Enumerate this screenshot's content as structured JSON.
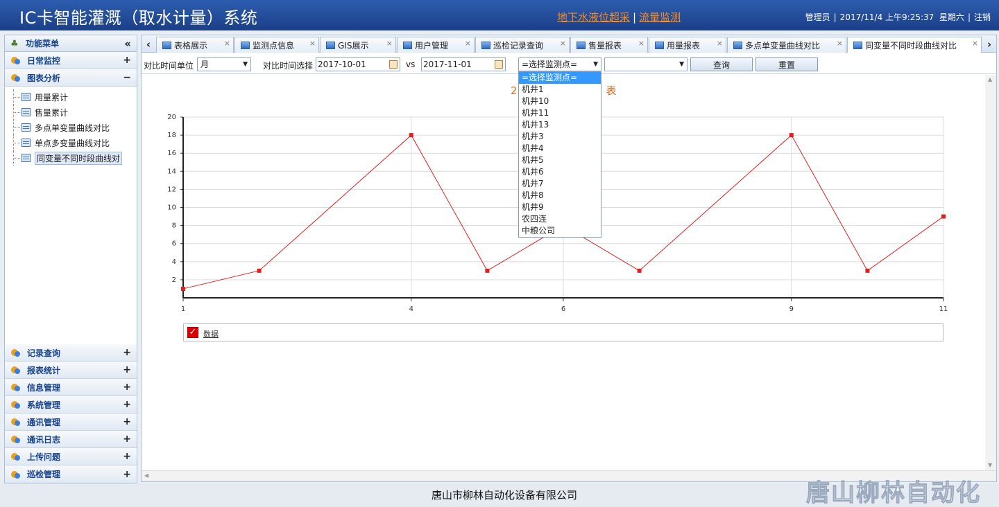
{
  "header": {
    "title": "IC卡智能灌溉（取水计量）系统",
    "link1": "地下水液位超采",
    "link_sep": "|",
    "link2": "流量监测",
    "user": "管理员",
    "datetime": "2017/11/4 上午9:25:37",
    "weekday": "星期六",
    "logout": "注销"
  },
  "sidebar": {
    "title": "功能菜单",
    "collapse": "«",
    "sections": [
      {
        "label": "日常监控",
        "toggle": "+"
      },
      {
        "label": "图表分析",
        "toggle": "−"
      }
    ],
    "tree": [
      "用量累计",
      "售量累计",
      "多点单变量曲线对比",
      "单点多变量曲线对比",
      "同变量不同时段曲线对"
    ],
    "bottom_sections": [
      {
        "label": "记录查询",
        "toggle": "+"
      },
      {
        "label": "报表统计",
        "toggle": "+"
      },
      {
        "label": "信息管理",
        "toggle": "+"
      },
      {
        "label": "系统管理",
        "toggle": "+"
      },
      {
        "label": "通讯管理",
        "toggle": "+"
      },
      {
        "label": "通讯日志",
        "toggle": "+"
      },
      {
        "label": "上传问题",
        "toggle": "+"
      },
      {
        "label": "巡检管理",
        "toggle": "+"
      }
    ]
  },
  "tabs": {
    "scroll_left": "‹",
    "scroll_right": "›",
    "close": "×",
    "items": [
      "表格展示",
      "监测点信息",
      "GIS展示",
      "用户管理",
      "巡检记录查询",
      "售量报表",
      "用量报表",
      "多点单变量曲线对比",
      "同变量不同时段曲线对比"
    ]
  },
  "toolbar": {
    "unit_label": "对比时间单位",
    "unit_value": "月",
    "time_label": "对比时间选择",
    "date_from": "2017-10-01",
    "vs": "vs",
    "date_to": "2017-11-01",
    "monitor_value": "=选择监测点=",
    "variable_value": "",
    "query": "查询",
    "reset": "重置"
  },
  "dropdown": {
    "options": [
      "=选择监测点=",
      "机井1",
      "机井10",
      "机井11",
      "机井13",
      "机井3",
      "机井4",
      "机井5",
      "机井6",
      "机井7",
      "机井8",
      "机井9",
      "农四连",
      "中粮公司"
    ]
  },
  "chart": {
    "title_left": "2",
    "title_right": "表",
    "legend_label": "数据",
    "legend_check": "✓"
  },
  "chart_data": {
    "type": "line",
    "x": [
      1,
      2,
      4,
      5,
      6,
      7,
      9,
      10,
      11
    ],
    "x_ticks": [
      1,
      4,
      6,
      9,
      11
    ],
    "series": [
      {
        "name": "数据",
        "values": [
          1,
          3,
          18,
          3,
          8,
          3,
          18,
          3,
          9
        ]
      }
    ],
    "ylim": [
      0,
      20
    ],
    "y_ticks": [
      2,
      4,
      6,
      8,
      10,
      12,
      14,
      16,
      18,
      20
    ],
    "grid": true,
    "line_color": "#e02020",
    "legend_position": "bottom"
  },
  "footer": {
    "company": "唐山市柳林自动化设备有限公司",
    "watermark": "唐山柳林自动化"
  }
}
